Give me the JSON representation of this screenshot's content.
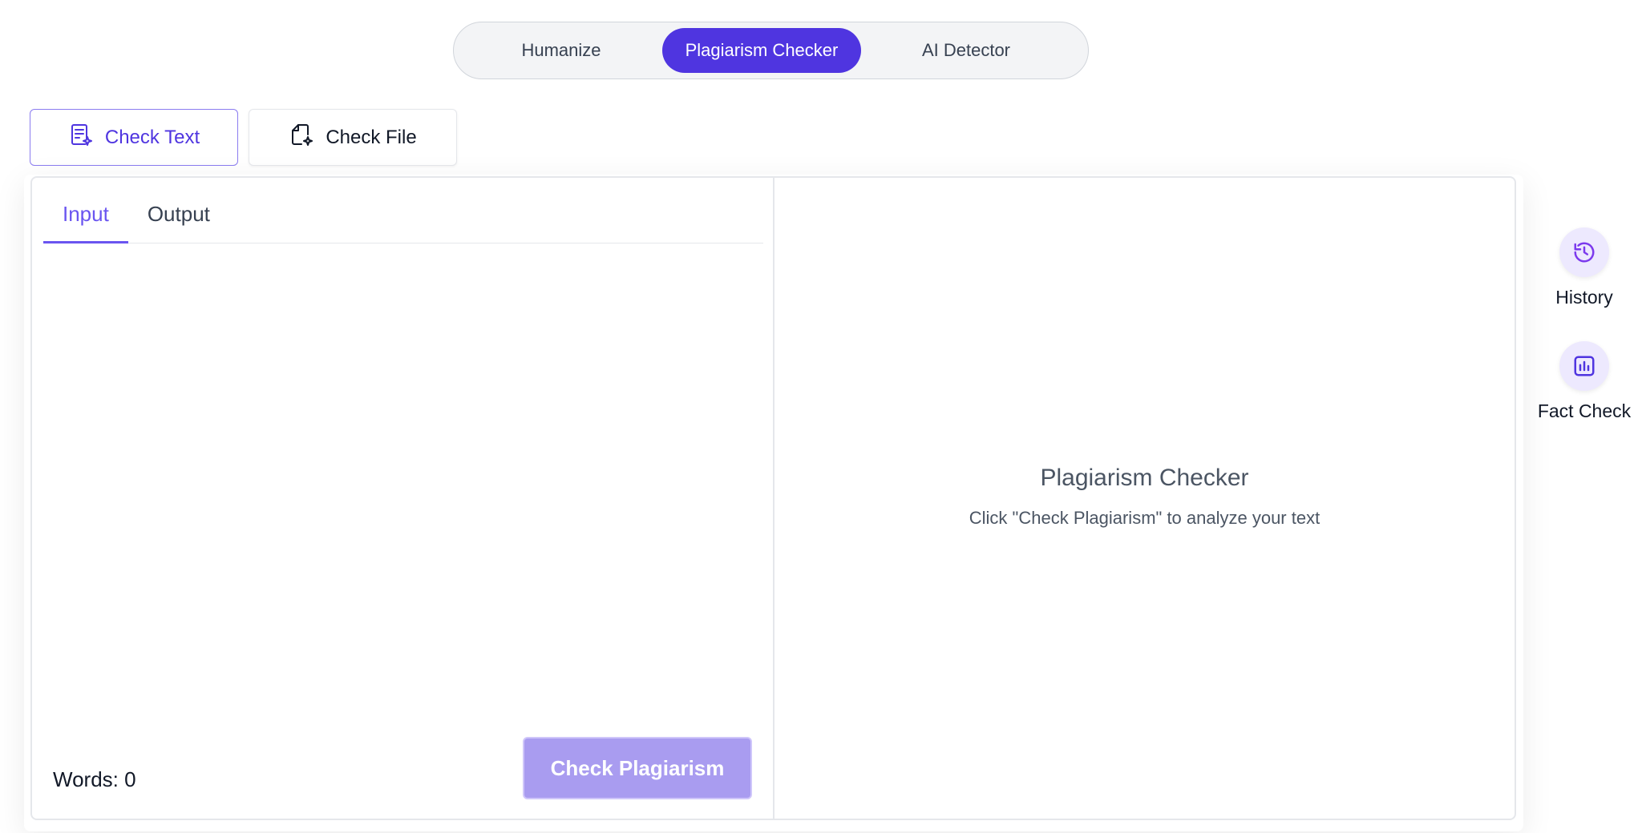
{
  "mode_switch": {
    "items": [
      {
        "label": "Humanize",
        "active": false
      },
      {
        "label": "Plagiarism Checker",
        "active": true
      },
      {
        "label": "AI Detector",
        "active": false
      }
    ]
  },
  "check_tabs": {
    "text_label": "Check Text",
    "file_label": "Check File",
    "active": "Check Text"
  },
  "input_panel": {
    "tabs": [
      {
        "label": "Input",
        "active": true
      },
      {
        "label": "Output",
        "active": false
      }
    ],
    "text_value": "",
    "word_count_label": "Words: 0",
    "check_button_label": "Check Plagiarism"
  },
  "result_panel": {
    "title": "Plagiarism Checker",
    "subtitle": "Click \"Check Plagiarism\" to analyze your text"
  },
  "side_rail": {
    "history_label": "History",
    "fact_check_label": "Fact Check"
  },
  "icons": {
    "check_text": "document-sparkle-icon",
    "check_file": "file-sparkle-icon",
    "history": "history-icon",
    "fact_check": "bar-chart-icon"
  },
  "colors": {
    "accent": "#4f35e0",
    "accent_light": "#6a55f0",
    "button_disabled": "#a99cf0",
    "rail_icon_bg": "#ede9fe"
  }
}
